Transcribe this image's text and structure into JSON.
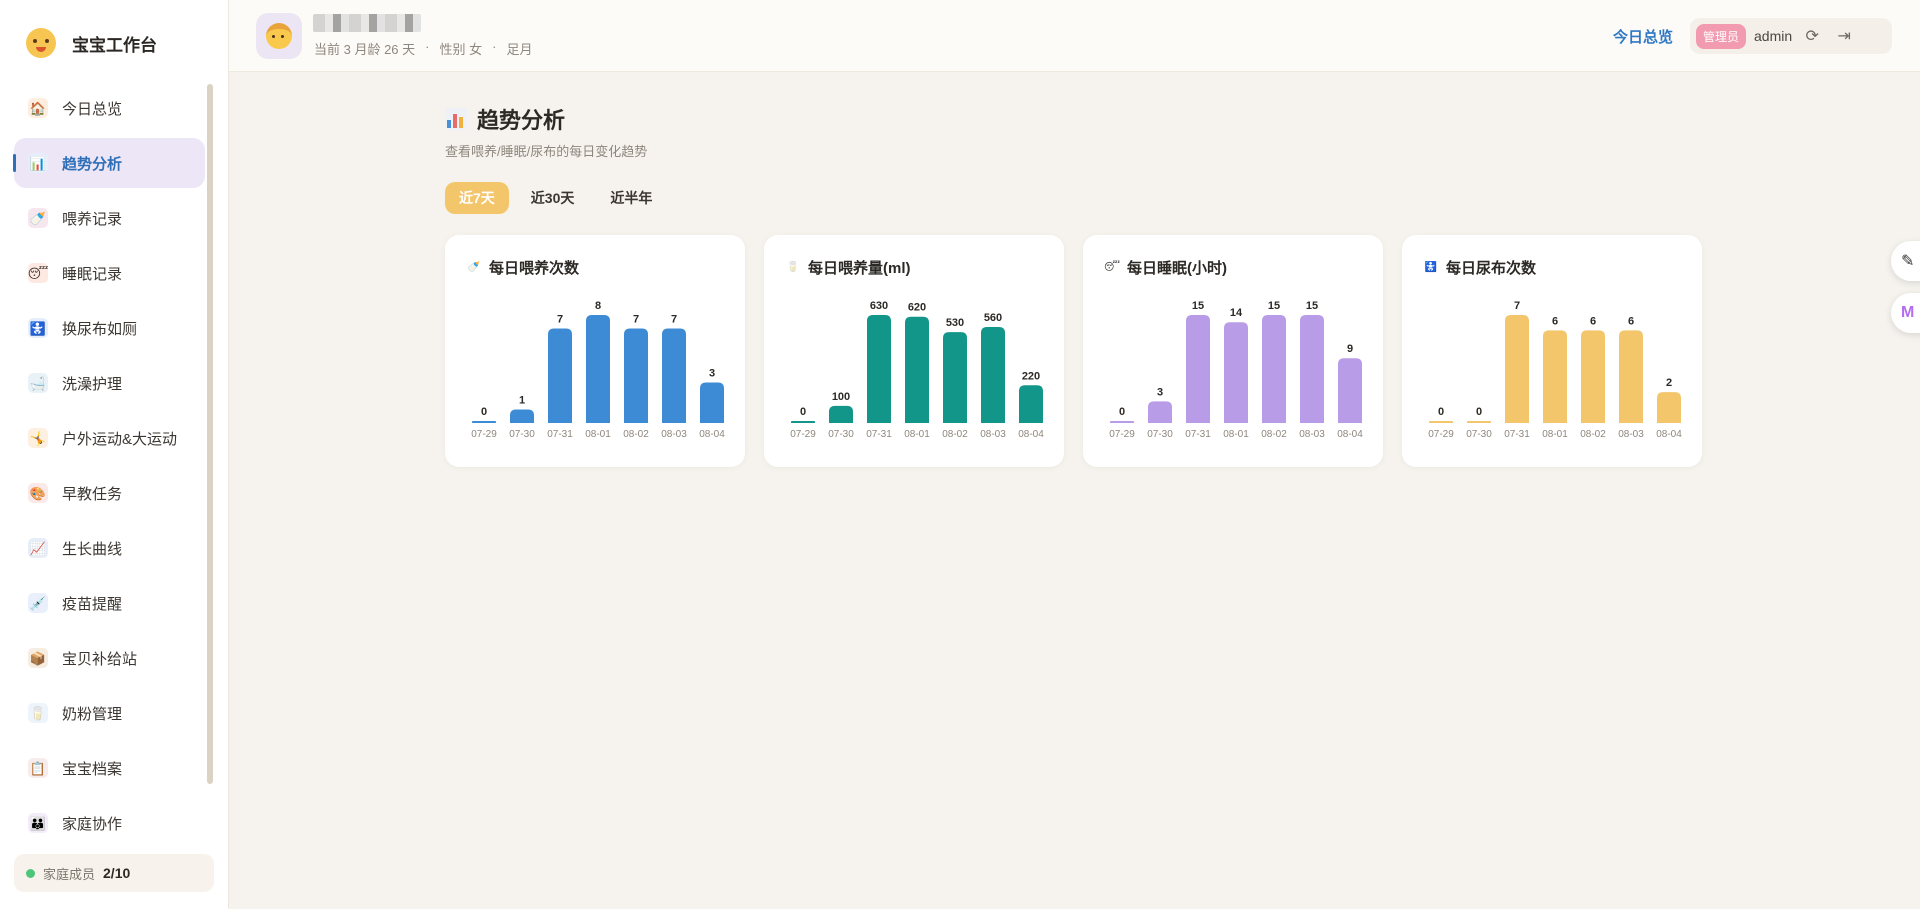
{
  "sidebar": {
    "brand": "宝宝工作台",
    "items": [
      {
        "label": "今日总览",
        "icon": "home-icon",
        "glyph": "🏠"
      },
      {
        "label": "趋势分析",
        "icon": "chart-icon",
        "glyph": "📊",
        "active": true
      },
      {
        "label": "喂养记录",
        "icon": "bottle-icon",
        "glyph": "🍼"
      },
      {
        "label": "睡眠记录",
        "icon": "sleep-icon",
        "glyph": "😴"
      },
      {
        "label": "换尿布如厕",
        "icon": "baby-icon",
        "glyph": "🚼"
      },
      {
        "label": "洗澡护理",
        "icon": "bath-icon",
        "glyph": "🛁"
      },
      {
        "label": "户外运动&大运动",
        "icon": "sport-icon",
        "glyph": "🤸"
      },
      {
        "label": "早教任务",
        "icon": "palette-icon",
        "glyph": "🎨"
      },
      {
        "label": "生长曲线",
        "icon": "growth-icon",
        "glyph": "📈"
      },
      {
        "label": "疫苗提醒",
        "icon": "syringe-icon",
        "glyph": "💉"
      },
      {
        "label": "宝贝补给站",
        "icon": "package-icon",
        "glyph": "📦"
      },
      {
        "label": "奶粉管理",
        "icon": "cup-icon",
        "glyph": "🥛"
      },
      {
        "label": "宝宝档案",
        "icon": "clipboard-icon",
        "glyph": "📋"
      },
      {
        "label": "家庭协作",
        "icon": "family-icon",
        "glyph": "👪"
      }
    ],
    "family_label": "家庭成员",
    "family_count": "2/10"
  },
  "header": {
    "age": "当前 3 月龄 26 天",
    "sep1": "·",
    "gender": "性别 女",
    "sep2": "·",
    "term": "足月",
    "link": "今日总览",
    "role": "管理员",
    "user": "admin"
  },
  "main": {
    "title": "趋势分析",
    "subtitle": "查看喂养/睡眠/尿布的每日变化趋势",
    "tabs": [
      {
        "label": "近7天",
        "active": true
      },
      {
        "label": "近30天"
      },
      {
        "label": "近半年"
      }
    ]
  },
  "chart_data": [
    {
      "type": "bar",
      "title": "每日喂养次数",
      "color": "#3d8bd4",
      "icon": "bottle-icon",
      "categories": [
        "07-29",
        "07-30",
        "07-31",
        "08-01",
        "08-02",
        "08-03",
        "08-04"
      ],
      "values": [
        0,
        1,
        7,
        8,
        7,
        7,
        3
      ]
    },
    {
      "type": "bar",
      "title": "每日喂养量(ml)",
      "color": "#12968a",
      "icon": "cup-icon",
      "categories": [
        "07-29",
        "07-30",
        "07-31",
        "08-01",
        "08-02",
        "08-03",
        "08-04"
      ],
      "values": [
        0,
        100,
        630,
        620,
        530,
        560,
        220
      ]
    },
    {
      "type": "bar",
      "title": "每日睡眠(小时)",
      "color": "#b89ce8",
      "icon": "sleep-icon",
      "categories": [
        "07-29",
        "07-30",
        "07-31",
        "08-01",
        "08-02",
        "08-03",
        "08-04"
      ],
      "values": [
        0,
        3,
        15,
        14,
        15,
        15,
        9
      ]
    },
    {
      "type": "bar",
      "title": "每日尿布次数",
      "color": "#f4c66c",
      "icon": "baby-icon",
      "categories": [
        "07-29",
        "07-30",
        "07-31",
        "08-01",
        "08-02",
        "08-03",
        "08-04"
      ],
      "values": [
        0,
        0,
        7,
        6,
        6,
        6,
        2
      ]
    }
  ]
}
